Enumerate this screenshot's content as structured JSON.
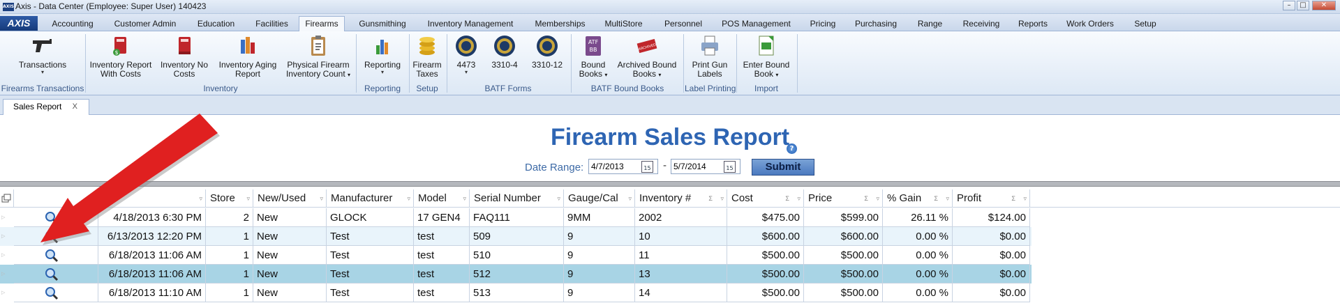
{
  "window": {
    "title": "Axis - Data Center  (Employee: Super User) 140423",
    "app_icon_text": "AXIS",
    "controls": {
      "minimize": "–",
      "maximize": "□",
      "close": "✕"
    }
  },
  "menu": {
    "logo": "AXIS",
    "tabs": [
      "Accounting",
      "Customer Admin",
      "Education",
      "Facilities",
      "Firearms",
      "Gunsmithing",
      "Inventory Management",
      "Memberships",
      "MultiStore",
      "Personnel",
      "POS Management",
      "Pricing",
      "Purchasing",
      "Range",
      "Receiving",
      "Reports",
      "Work Orders",
      "Setup"
    ],
    "active_tab": "Firearms"
  },
  "ribbon": {
    "buttons": {
      "transactions": "Transactions",
      "inv_costs_1": "Inventory Report",
      "inv_costs_2": "With Costs",
      "inv_nocosts_1": "Inventory No",
      "inv_nocosts_2": "Costs",
      "inv_aging_1": "Inventory Aging",
      "inv_aging_2": "Report",
      "phys_count_1": "Physical Firearm",
      "phys_count_2": "Inventory Count",
      "reporting": "Reporting",
      "taxes_1": "Firearm",
      "taxes_2": "Taxes",
      "f4473": "4473",
      "f3310_4": "3310-4",
      "f3310_12": "3310-12",
      "bound_1": "Bound",
      "bound_2": "Books",
      "archived_1": "Archived Bound",
      "archived_2": "Books",
      "print_labels_1": "Print Gun",
      "print_labels_2": "Labels",
      "enter_bound_1": "Enter Bound",
      "enter_bound_2": "Book",
      "dropdown": "▾"
    },
    "groups": {
      "firearms_transactions": "Firearms Transactions",
      "inventory": "Inventory",
      "reporting": "Reporting",
      "setup": "Setup",
      "batf_forms": "BATF Forms",
      "batf_bound_books": "BATF Bound Books",
      "label_printing": "Label Printing",
      "import": "Import"
    },
    "icon_text": {
      "atf": "ATF",
      "bb": "BB",
      "archived": "ARCHIVED"
    }
  },
  "doc_tab": {
    "label": "Sales Report",
    "close": "X"
  },
  "report": {
    "title": "Firearm Sales Report",
    "help": "?",
    "date_range_label": "Date Range:",
    "date_from": "4/7/2013",
    "date_to": "5/7/2014",
    "date_sep": "-",
    "calendar_day": "15",
    "submit": "Submit"
  },
  "grid": {
    "columns": [
      "",
      "ate",
      "Store",
      "New/Used",
      "Manufacturer",
      "Model",
      "Serial Number",
      "Gauge/Cal",
      "Inventory #",
      "Cost",
      "Price",
      "% Gain",
      "Profit"
    ],
    "sum_glyph": "Σ",
    "filter_glyph": "▿",
    "rows": [
      {
        "date": "4/18/2013 6:30 PM",
        "store": "2",
        "new_used": "New",
        "manufacturer": "GLOCK",
        "model": "17 GEN4",
        "serial": "FAQ111",
        "gauge": "9MM",
        "inventory": "2002",
        "cost": "$475.00",
        "price": "$599.00",
        "gain": "26.11 %",
        "profit": "$124.00"
      },
      {
        "date": "6/13/2013 12:20 PM",
        "store": "1",
        "new_used": "New",
        "manufacturer": "Test",
        "model": "test",
        "serial": "509",
        "gauge": "9",
        "inventory": "10",
        "cost": "$600.00",
        "price": "$600.00",
        "gain": "0.00 %",
        "profit": "$0.00"
      },
      {
        "date": "6/18/2013 11:06 AM",
        "store": "1",
        "new_used": "New",
        "manufacturer": "Test",
        "model": "test",
        "serial": "510",
        "gauge": "9",
        "inventory": "11",
        "cost": "$500.00",
        "price": "$500.00",
        "gain": "0.00 %",
        "profit": "$0.00"
      },
      {
        "date": "6/18/2013 11:06 AM",
        "store": "1",
        "new_used": "New",
        "manufacturer": "Test",
        "model": "test",
        "serial": "512",
        "gauge": "9",
        "inventory": "13",
        "cost": "$500.00",
        "price": "$500.00",
        "gain": "0.00 %",
        "profit": "$0.00"
      },
      {
        "date": "6/18/2013 11:10 AM",
        "store": "1",
        "new_used": "New",
        "manufacturer": "Test",
        "model": "test",
        "serial": "513",
        "gauge": "9",
        "inventory": "14",
        "cost": "$500.00",
        "price": "$500.00",
        "gain": "0.00 %",
        "profit": "$0.00"
      }
    ]
  },
  "colors": {
    "accent": "#2e65b3",
    "arrow": "#e02020",
    "selected_row": "#a8d4e5",
    "alt_row": "#e9f4fb"
  }
}
